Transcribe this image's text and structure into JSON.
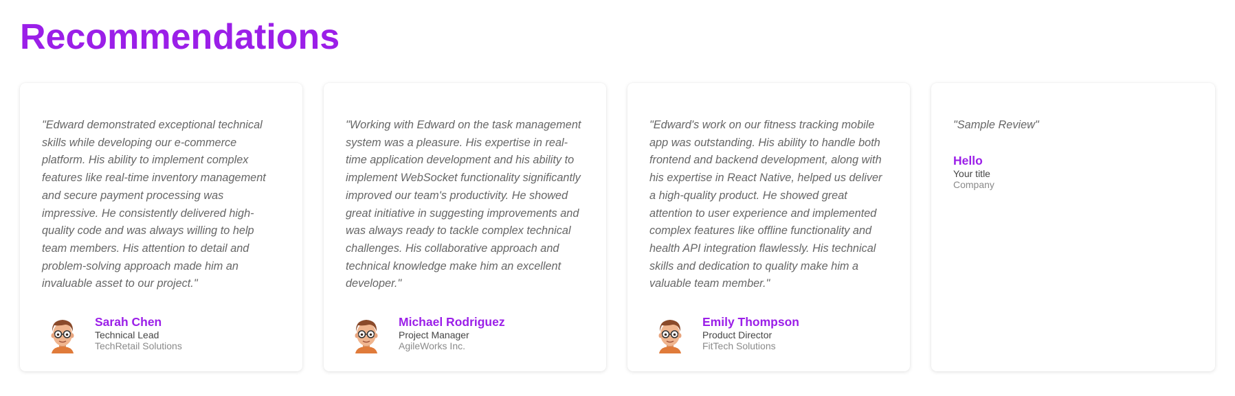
{
  "page": {
    "title": "Recommendations"
  },
  "colors": {
    "accent": "#9b1fe8",
    "quote_text": "#666666",
    "author_title": "#444444",
    "author_company": "#8a8a8a"
  },
  "recommendations": [
    {
      "quote": "\"Edward demonstrated exceptional technical skills while developing our e-commerce platform. His ability to implement complex features like real-time inventory management and secure payment processing was impressive. He consistently delivered high-quality code and was always willing to help team members. His attention to detail and problem-solving approach made him an invaluable asset to our project.\"",
      "name": "Sarah Chen",
      "title": "Technical Lead",
      "company": "TechRetail Solutions",
      "avatar_icon": "cartoon-avatar-icon"
    },
    {
      "quote": "\"Working with Edward on the task management system was a pleasure. His expertise in real-time application development and his ability to implement WebSocket functionality significantly improved our team's productivity. He showed great initiative in suggesting improvements and was always ready to tackle complex technical challenges. His collaborative approach and technical knowledge make him an excellent developer.\"",
      "name": "Michael Rodriguez",
      "title": "Project Manager",
      "company": "AgileWorks Inc.",
      "avatar_icon": "cartoon-avatar-icon"
    },
    {
      "quote": "\"Edward's work on our fitness tracking mobile app was outstanding. His ability to handle both frontend and backend development, along with his expertise in React Native, helped us deliver a high-quality product. He showed great attention to user experience and implemented complex features like offline functionality and health API integration flawlessly. His technical skills and dedication to quality make him a valuable team member.\"",
      "name": "Emily Thompson",
      "title": "Product Director",
      "company": "FitTech Solutions",
      "avatar_icon": "cartoon-avatar-icon"
    },
    {
      "quote": "\"Sample Review\"",
      "name": "Hello",
      "title": "Your title",
      "company": "Company"
    }
  ]
}
